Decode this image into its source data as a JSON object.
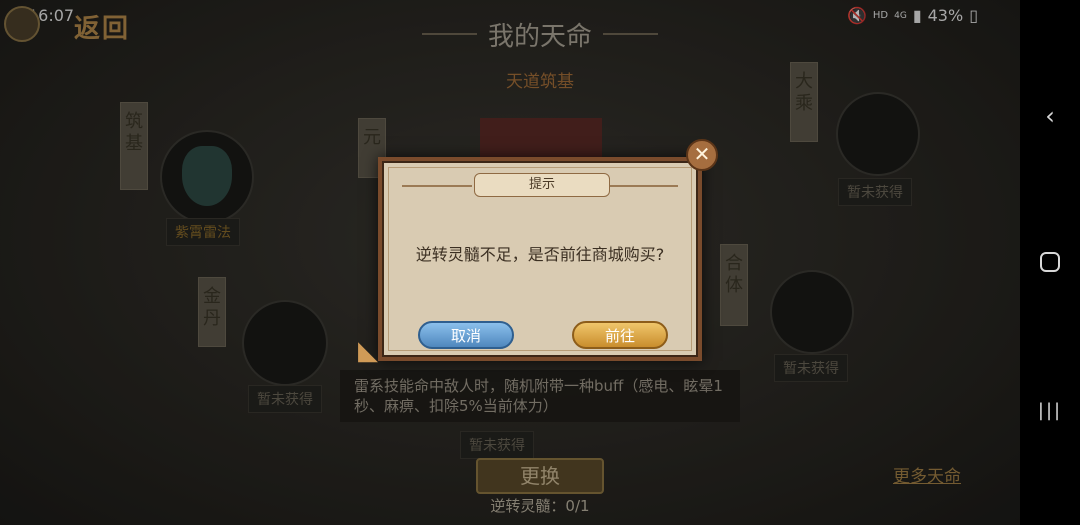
{
  "status": {
    "time": "16:07",
    "battery": "43%",
    "hd": "HD",
    "net": "4G"
  },
  "header": {
    "back_label": "返回",
    "title": "我的天命",
    "subtitle": "天道筑基"
  },
  "nodes": {
    "left_top_scroll": "筑基",
    "left_top_label": "紫霄雷法",
    "left_bottom_scroll": "金丹",
    "left_bottom_label": "暂未获得",
    "center_scroll": "元",
    "center_bottom_label": "暂未获得",
    "right_top_scroll": "大乘",
    "right_top_label": "暂未获得",
    "right_bottom_scroll": "合体",
    "right_bottom_label": "暂未获得"
  },
  "description": "雷系技能命中敌人时，随机附带一种buff（感电、眩晕1秒、麻痹、扣除5%当前体力）",
  "footer": {
    "change_label": "更换",
    "more_label": "更多天命",
    "reverse_count": "逆转灵髓：0/1"
  },
  "dialog": {
    "tag": "提示",
    "message": "逆转灵髓不足，是否前往商城购买?",
    "cancel_label": "取消",
    "confirm_label": "前往"
  }
}
